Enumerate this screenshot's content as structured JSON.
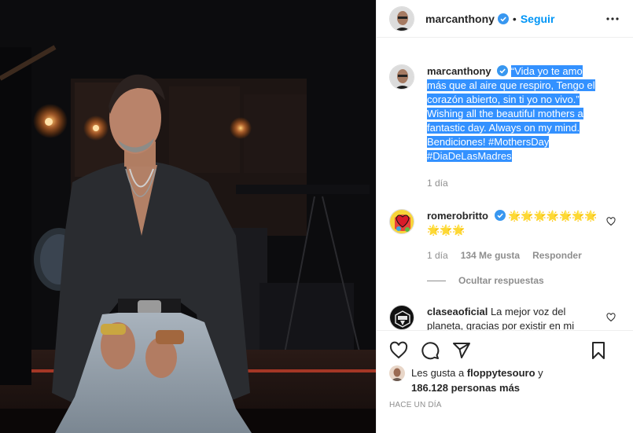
{
  "post": {
    "author": "marcanthony",
    "dot": "•",
    "follow_label": "Seguir"
  },
  "caption": {
    "author": "marcanthony",
    "text": "“Vida yo te amo más que al aire que respiro, Tengo el corazón abierto, sin ti yo no vivo.” Wishing all the beautiful mothers a fantastic day. Always on my mind. Bendiciones! #MothersDay #DiaDeLasMadres",
    "time": "1 día"
  },
  "comments": [
    {
      "author": "romerobritto",
      "text": "🌟🌟🌟🌟🌟🌟🌟🌟🌟🌟",
      "time": "1 día",
      "likes": "134 Me gusta",
      "reply_label": "Responder",
      "hide_replies": "Ocultar respuestas"
    },
    {
      "author": "claseaoficial",
      "text": "La mejor voz del planeta, gracias por existir en mi"
    }
  ],
  "likes": {
    "prefix": "Les gusta a",
    "user": "floppytesouro",
    "and": "y",
    "count": "186.128 personas más"
  },
  "timestamp": "HACE UN DÍA",
  "colors": {
    "accent": "#0095f6",
    "selection": "#3391ff",
    "muted": "#8e8e8e"
  },
  "icons": [
    "more-options-icon",
    "verified-icon",
    "heart-icon",
    "comment-icon",
    "share-icon",
    "bookmark-icon"
  ]
}
